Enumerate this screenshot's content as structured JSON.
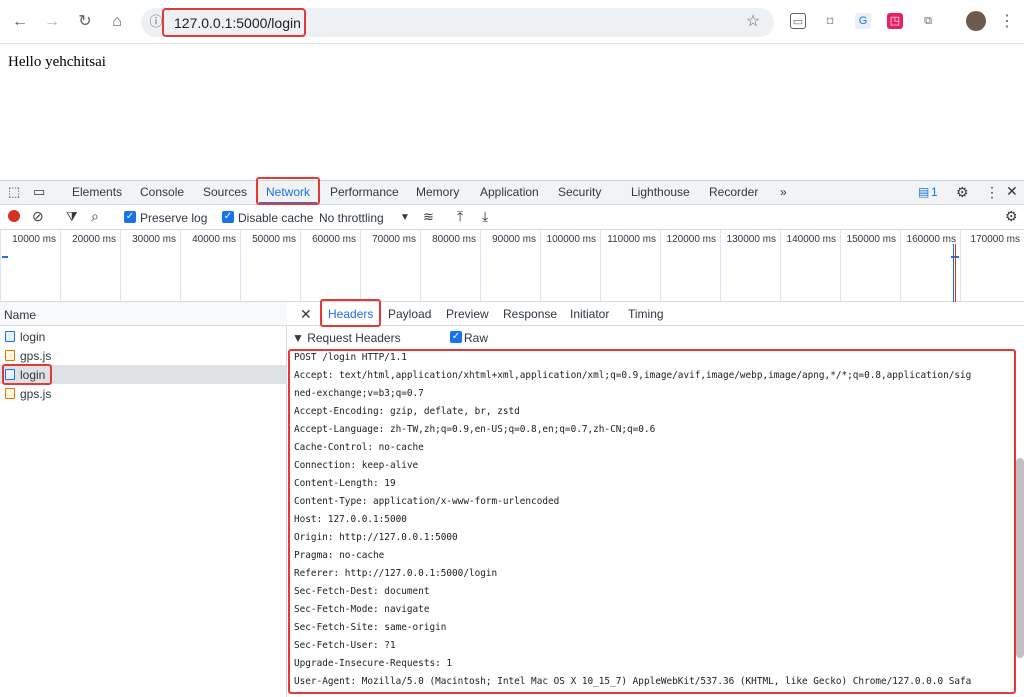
{
  "browser": {
    "url": "127.0.0.1:5000/login"
  },
  "page": {
    "content": "Hello yehchitsai"
  },
  "devtools": {
    "tabs": [
      "Elements",
      "Console",
      "Sources",
      "Network",
      "Performance",
      "Memory",
      "Application",
      "Security",
      "Lighthouse",
      "Recorder"
    ],
    "active_tab": "Network",
    "more_tabs": "»",
    "issues_count": "1",
    "filter": {
      "preserve_log": "Preserve log",
      "disable_cache": "Disable cache",
      "throttling": "No throttling"
    },
    "timeline_ticks": [
      "10000 ms",
      "20000 ms",
      "30000 ms",
      "40000 ms",
      "50000 ms",
      "60000 ms",
      "70000 ms",
      "80000 ms",
      "90000 ms",
      "100000 ms",
      "110000 ms",
      "120000 ms",
      "130000 ms",
      "140000 ms",
      "150000 ms",
      "160000 ms",
      "170000 ms"
    ],
    "name_column_header": "Name",
    "requests": [
      {
        "name": "login",
        "type": "doc"
      },
      {
        "name": "gps.js",
        "type": "js"
      },
      {
        "name": "login",
        "type": "doc"
      },
      {
        "name": "gps.js",
        "type": "js"
      }
    ],
    "detail_tabs": [
      "Headers",
      "Payload",
      "Preview",
      "Response",
      "Initiator",
      "Timing"
    ],
    "active_detail_tab": "Headers",
    "request_headers_title": "▼ Request Headers",
    "raw_label": "Raw",
    "raw_headers": [
      "POST /login HTTP/1.1",
      "Accept: text/html,application/xhtml+xml,application/xml;q=0.9,image/avif,image/webp,image/apng,*/*;q=0.8,application/sig",
      "ned-exchange;v=b3;q=0.7",
      "Accept-Encoding: gzip, deflate, br, zstd",
      "Accept-Language: zh-TW,zh;q=0.9,en-US;q=0.8,en;q=0.7,zh-CN;q=0.6",
      "Cache-Control: no-cache",
      "Connection: keep-alive",
      "Content-Length: 19",
      "Content-Type: application/x-www-form-urlencoded",
      "Host: 127.0.0.1:5000",
      "Origin: http://127.0.0.1:5000",
      "Pragma: no-cache",
      "Referer: http://127.0.0.1:5000/login",
      "Sec-Fetch-Dest: document",
      "Sec-Fetch-Mode: navigate",
      "Sec-Fetch-Site: same-origin",
      "Sec-Fetch-User: ?1",
      "Upgrade-Insecure-Requests: 1",
      "User-Agent: Mozilla/5.0 (Macintosh; Intel Mac OS X 10_15_7) AppleWebKit/537.36 (KHTML, like Gecko) Chrome/127.0.0.0 Safa"
    ]
  },
  "colors": {
    "accent": "#1a73e8",
    "highlight": "#e53935"
  }
}
